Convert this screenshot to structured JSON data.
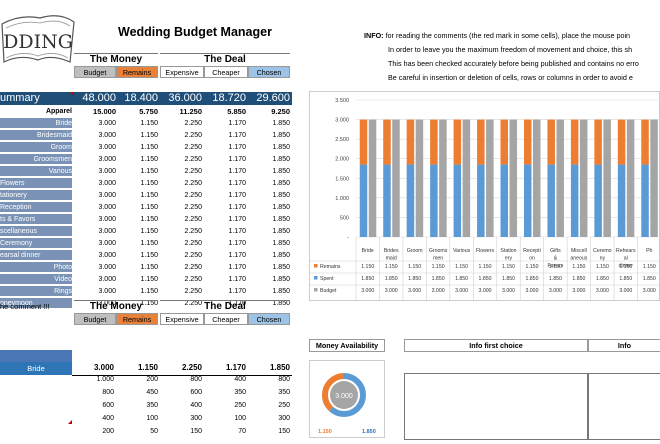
{
  "app": {
    "logo_text": "DDING",
    "title": "Wedding Budget Manager"
  },
  "info": {
    "label": "INFO:",
    "lines": [
      "for reading the comments (the red mark in some cells), place the mouse poin",
      "In order to leave you the maximum freedom of movement and choice, this sh",
      "This has been checked accurately before being published and contains no erro",
      "Be careful in insertion or deletion of cells, rows or columns in order to avoid e"
    ]
  },
  "headers": {
    "the_money": "The Money",
    "the_deal": "The Deal",
    "budget": "Budget",
    "remains": "Remains",
    "expensive": "Expensive",
    "cheaper": "Cheaper",
    "chosen": "Chosen"
  },
  "summary": {
    "label": "ummary",
    "values": [
      "48.000",
      "18.400",
      "36.000",
      "18.720",
      "29.600"
    ]
  },
  "rows": [
    {
      "name": "Apparel",
      "values": [
        "15.000",
        "5.750",
        "11.250",
        "5.850",
        "9.250"
      ],
      "bold": true
    },
    {
      "name": "Bride",
      "values": [
        "3.000",
        "1.150",
        "2.250",
        "1.170",
        "1.850"
      ]
    },
    {
      "name": "Bridesmaid",
      "values": [
        "3.000",
        "1.150",
        "2.250",
        "1.170",
        "1.850"
      ]
    },
    {
      "name": "Groom",
      "values": [
        "3.000",
        "1.150",
        "2.250",
        "1.170",
        "1.850"
      ]
    },
    {
      "name": "Groomsmen",
      "values": [
        "3.000",
        "1.150",
        "2.250",
        "1.170",
        "1.850"
      ]
    },
    {
      "name": "Various",
      "values": [
        "3.000",
        "1.150",
        "2.250",
        "1.170",
        "1.850"
      ]
    },
    {
      "name": "Flowers",
      "values": [
        "3.000",
        "1.150",
        "2.250",
        "1.170",
        "1.850"
      ],
      "left": true
    },
    {
      "name": "tationery",
      "values": [
        "3.000",
        "1.150",
        "2.250",
        "1.170",
        "1.850"
      ],
      "left": true
    },
    {
      "name": "Reception",
      "values": [
        "3.000",
        "1.150",
        "2.250",
        "1.170",
        "1.850"
      ],
      "left": true
    },
    {
      "name": "ts & Favors",
      "values": [
        "3.000",
        "1.150",
        "2.250",
        "1.170",
        "1.850"
      ],
      "left": true
    },
    {
      "name": "scellaneous",
      "values": [
        "3.000",
        "1.150",
        "2.250",
        "1.170",
        "1.850"
      ],
      "left": true
    },
    {
      "name": "Ceremony",
      "values": [
        "3.000",
        "1.150",
        "2.250",
        "1.170",
        "1.850"
      ],
      "left": true
    },
    {
      "name": "earsal dinner",
      "values": [
        "3.000",
        "1.150",
        "2.250",
        "1.170",
        "1.850"
      ],
      "left": true
    },
    {
      "name": "Photo",
      "values": [
        "3.000",
        "1.150",
        "2.250",
        "1.170",
        "1.850"
      ]
    },
    {
      "name": "Video",
      "values": [
        "3.000",
        "1.150",
        "2.250",
        "1.170",
        "1.850"
      ]
    },
    {
      "name": "Rings",
      "values": [
        "3.000",
        "1.150",
        "2.250",
        "1.170",
        "1.850"
      ]
    },
    {
      "name": "oneymoon",
      "values": [
        "3.000",
        "1.150",
        "2.250",
        "1.170",
        "1.850"
      ],
      "left": true
    }
  ],
  "chart_data": {
    "type": "bar",
    "stacked": true,
    "categories": [
      "Bride",
      "Brides maid",
      "Groom",
      "Grooms men",
      "Various",
      "Flowers",
      "Station ery",
      "Recepti on",
      "Gifts & Favors",
      "Miscell aneous",
      "Ceremo ny",
      "Rehears al dinner",
      "Ph"
    ],
    "series": [
      {
        "name": "Remains",
        "values": [
          1150,
          1150,
          1150,
          1150,
          1150,
          1150,
          1150,
          1150,
          1150,
          1150,
          1150,
          1150,
          1150
        ],
        "color": "#ed7d31"
      },
      {
        "name": "Spent",
        "values": [
          1850,
          1850,
          1850,
          1850,
          1850,
          1850,
          1850,
          1850,
          1850,
          1850,
          1850,
          1850,
          1850
        ],
        "color": "#5b9bd5"
      },
      {
        "name": "Budget",
        "values": [
          3000,
          3000,
          3000,
          3000,
          3000,
          3000,
          3000,
          3000,
          3000,
          3000,
          3000,
          3000,
          3000
        ],
        "color": "#a5a5a5"
      }
    ],
    "table_values": {
      "Remains": [
        "1.150",
        "1.150",
        "1.150",
        "1.150",
        "1.150",
        "1.150",
        "1.150",
        "1.150",
        "1.150",
        "1.150",
        "1.150",
        "1.150",
        "1.150"
      ],
      "Spent": [
        "1.850",
        "1.850",
        "1.850",
        "1.850",
        "1.850",
        "1.850",
        "1.850",
        "1.850",
        "1.850",
        "1.850",
        "1.850",
        "1.850",
        "1.850"
      ],
      "Budget": [
        "3.000",
        "3.000",
        "3.000",
        "3.000",
        "3.000",
        "3.000",
        "3.000",
        "3.000",
        "3.000",
        "3.000",
        "3.000",
        "3.000",
        "3.000"
      ]
    },
    "y_ticks": [
      "3.500",
      "3.000",
      "2.500",
      "2.000",
      "1.500",
      "1.000",
      "500",
      "-"
    ],
    "ylim": [
      0,
      3500
    ],
    "grid": true
  },
  "lower": {
    "comment_label": "he comment !!!",
    "headers": {
      "the_money": "The Money",
      "the_deal": "The Deal",
      "budget": "Budget",
      "remains": "Remains",
      "expensive": "Expensive",
      "cheaper": "Cheaper",
      "chosen": "Chosen"
    },
    "bride_label": "Bride",
    "bride_values": [
      "3.000",
      "1.150",
      "2.250",
      "1.170",
      "1.850"
    ],
    "rows": [
      [
        "1.000",
        "200",
        "800",
        "400",
        "800"
      ],
      [
        "800",
        "450",
        "600",
        "350",
        "350"
      ],
      [
        "600",
        "350",
        "400",
        "250",
        "250"
      ],
      [
        "400",
        "100",
        "300",
        "100",
        "300"
      ],
      [
        "200",
        "50",
        "150",
        "70",
        "150"
      ]
    ]
  },
  "panels": {
    "money_availability": "Money Availability",
    "donut_center": "3.000",
    "donut_remains": "1.150",
    "donut_spent": "1.850",
    "info_first": "Info first choice",
    "info_second": "Info"
  }
}
